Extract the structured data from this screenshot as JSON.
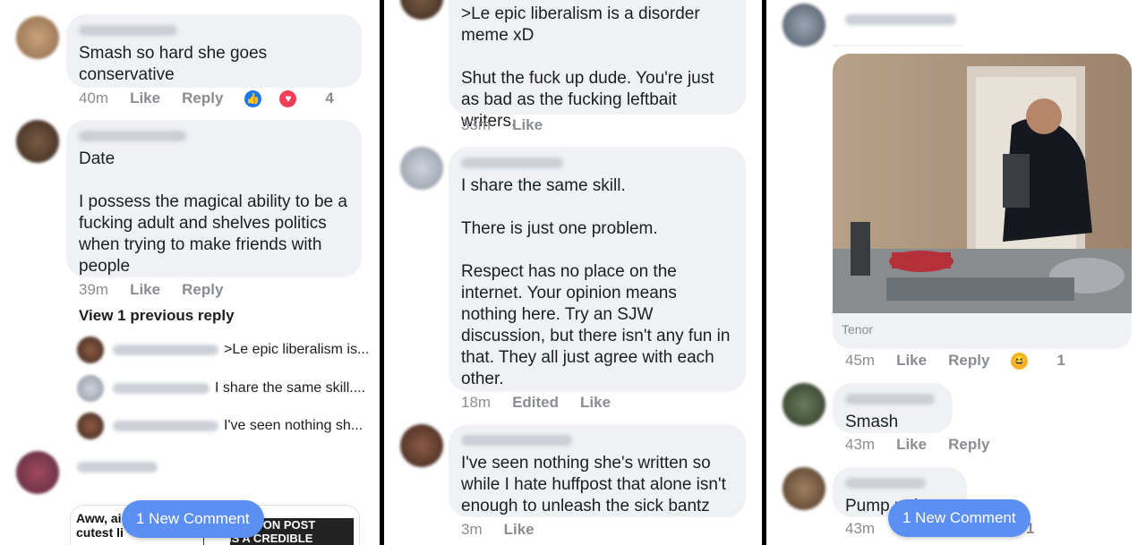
{
  "panel1": {
    "comments": [
      {
        "text": "Smash so hard she goes conservative",
        "time": "40m",
        "like": "Like",
        "reply": "Reply",
        "reaction_count": "4"
      },
      {
        "text": "Date\n\nI possess the magical ability to be a fucking adult and shelves politics when trying to make friends with people",
        "time": "39m",
        "like": "Like",
        "reply": "Reply"
      }
    ],
    "view_previous": "View 1 previous reply",
    "replies": [
      {
        "preview": ">Le epic liberalism is..."
      },
      {
        "preview": "I share the same skill...."
      },
      {
        "preview": "I've seen nothing sh..."
      }
    ],
    "meme_left": "Aww, ai\ncutest li",
    "meme_right": "FINGTON POST\nIS A CREDIBLE SOURCE",
    "new_comment": "1 New Comment"
  },
  "panel2": {
    "comments": [
      {
        "text": ">Le epic liberalism is a disorder meme xD\n\nShut the fuck up dude. You're just as bad as the fucking leftbait writers.",
        "time": "33m",
        "like": "Like"
      },
      {
        "text": "I share the same skill.\n\nThere is just one problem.\n\nRespect has no place on the internet. Your opinion means nothing here. Try an SJW discussion, but there isn't any fun in that. They all just agree with each other.",
        "time": "18m",
        "edited": "Edited",
        "like": "Like"
      },
      {
        "text": "I've seen nothing she's written so while I hate huffpost that alone isn't enough to unleash the sick bantz",
        "time": "3m",
        "like": "Like"
      }
    ]
  },
  "panel3": {
    "gif_source": "Tenor",
    "gif_meta": {
      "time": "45m",
      "like": "Like",
      "reply": "Reply",
      "reaction_count": "1"
    },
    "comments": [
      {
        "text": "Smash",
        "time": "43m",
        "like": "Like",
        "reply": "Reply"
      },
      {
        "text": "Pump n dump",
        "time": "43m",
        "reaction_count": "1"
      }
    ],
    "new_comment": "1 New Comment"
  },
  "colors": {
    "bubble": "#f0f1f4",
    "meta": "#8a8d91",
    "button": "#5b8ff2",
    "like": "#1877f2",
    "love": "#f33e58",
    "haha": "#f7b125"
  },
  "icons": {
    "like": "thumbs-up-icon",
    "love": "heart-icon",
    "haha": "laughing-emoji-icon"
  }
}
